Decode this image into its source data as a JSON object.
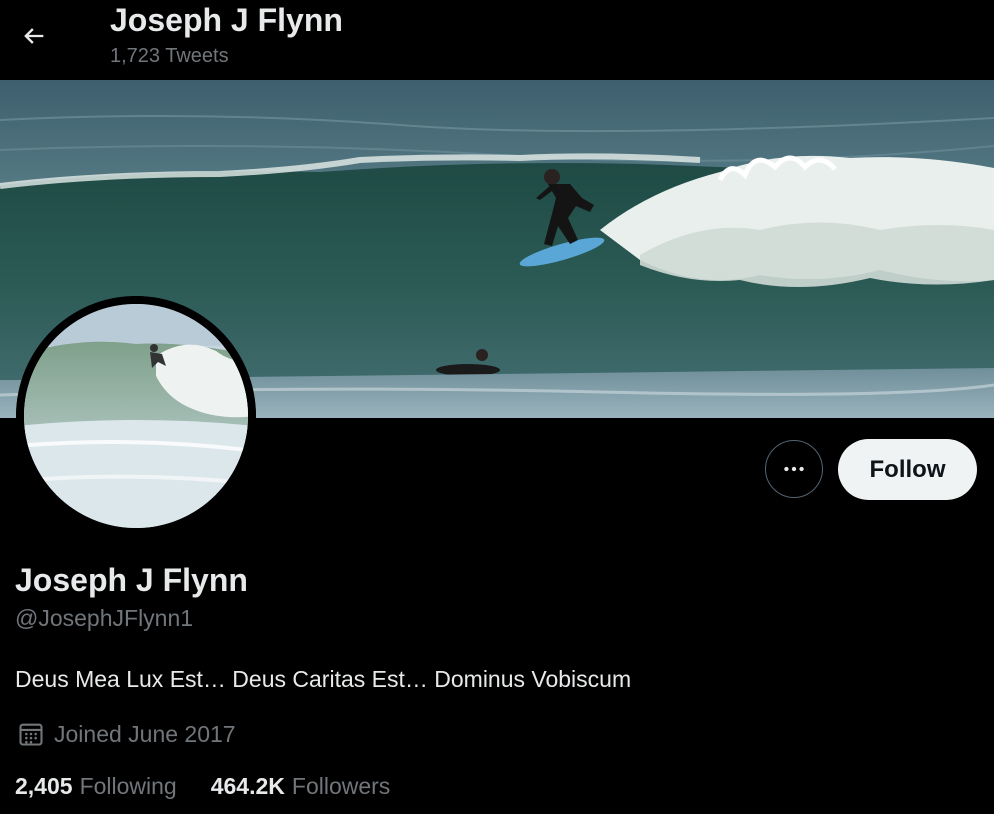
{
  "header": {
    "name": "Joseph J Flynn",
    "tweet_count": "1,723 Tweets",
    "back_icon": "arrow-left-icon"
  },
  "profile": {
    "display_name": "Joseph J Flynn",
    "handle": "@JosephJFlynn1",
    "bio": "Deus Mea Lux Est… Deus Caritas Est… Dominus Vobiscum",
    "joined": "Joined June 2017",
    "calendar_icon": "calendar-icon",
    "following_count": "2,405",
    "following_label": "Following",
    "followers_count": "464.2K",
    "followers_label": "Followers"
  },
  "actions": {
    "more_icon": "more-horizontal-icon",
    "follow_label": "Follow"
  },
  "colors": {
    "background": "#000000",
    "primary_text": "#e7e9ea",
    "secondary_text": "#71767b",
    "follow_button_bg": "#eff3f4",
    "follow_button_text": "#0f1419",
    "border": "#536471"
  },
  "images": {
    "banner": "surfer riding a wave",
    "avatar": "surfer on a wave"
  }
}
